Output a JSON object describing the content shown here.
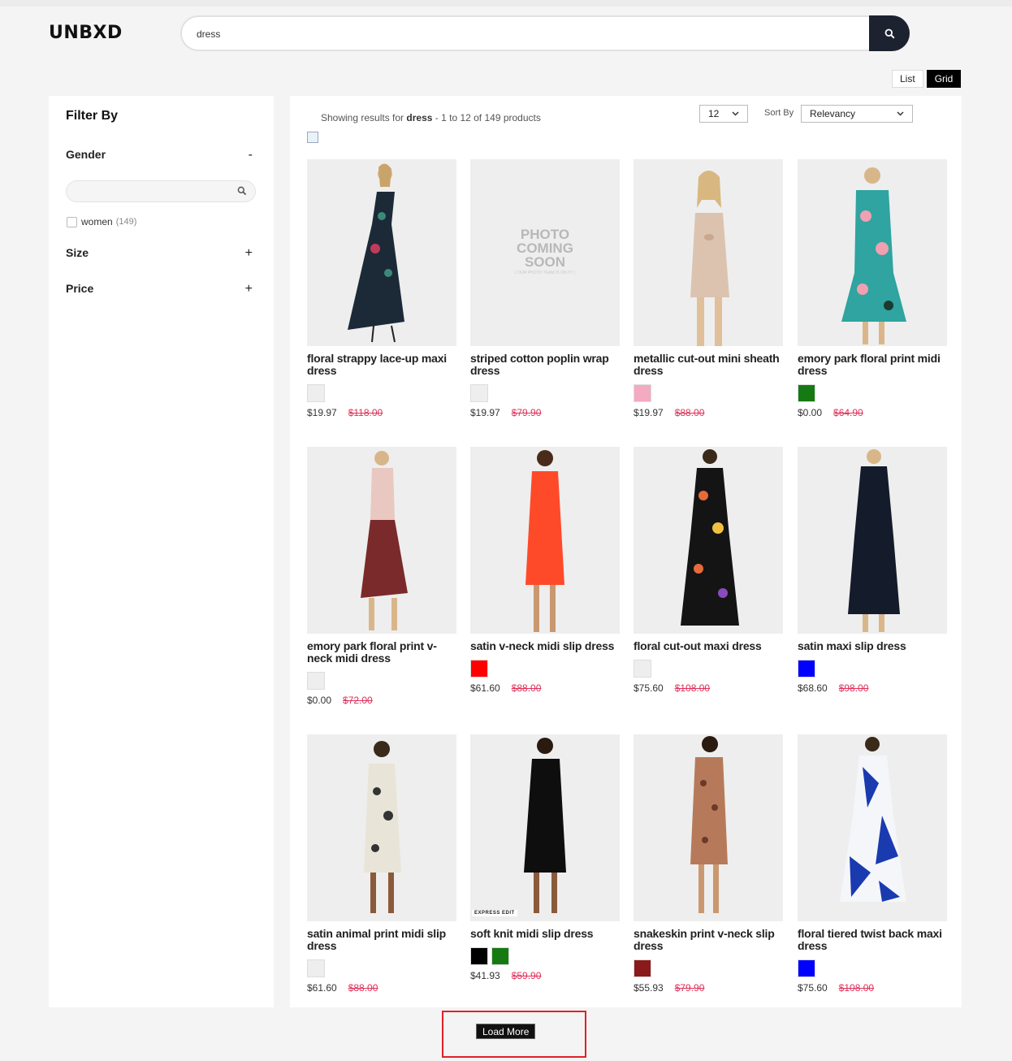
{
  "brand": "UNBXD",
  "search": {
    "value": "dress"
  },
  "view": {
    "list_label": "List",
    "grid_label": "Grid"
  },
  "sidebar": {
    "title": "Filter By",
    "facets": [
      {
        "label": "Gender",
        "toggle": "-"
      },
      {
        "label": "Size",
        "toggle": "+"
      },
      {
        "label": "Price",
        "toggle": "+"
      }
    ],
    "gender_options": [
      {
        "label": "women",
        "count": "(149)"
      }
    ]
  },
  "results": {
    "showing_prefix": "Showing results for",
    "query": "dress",
    "showing_suffix": "- 1 to 12 of 149 products",
    "per_page": "12",
    "sort_label": "Sort By",
    "sort_value": "Relevancy"
  },
  "products": [
    {
      "name": "floral strappy lace-up maxi dress",
      "price": "$19.97",
      "was": "$118.00",
      "swatches": [
        "#eeeeee"
      ]
    },
    {
      "name": "striped cotton poplin wrap dress",
      "price": "$19.97",
      "was": "$79.90",
      "swatches": [
        "#eeeeee"
      ]
    },
    {
      "name": "metallic cut-out mini sheath dress",
      "price": "$19.97",
      "was": "$88.00",
      "swatches": [
        "#f4aac0"
      ]
    },
    {
      "name": "emory park floral print midi dress",
      "price": "$0.00",
      "was": "$64.90",
      "swatches": [
        "#167a12"
      ]
    },
    {
      "name": "emory park floral print v-neck midi dress",
      "price": "$0.00",
      "was": "$72.00",
      "swatches": [
        "#eeeeee"
      ]
    },
    {
      "name": "satin v-neck midi slip dress",
      "price": "$61.60",
      "was": "$88.00",
      "swatches": [
        "#ff0000"
      ]
    },
    {
      "name": "floral cut-out maxi dress",
      "price": "$75.60",
      "was": "$108.00",
      "swatches": [
        "#eeeeee"
      ]
    },
    {
      "name": "satin maxi slip dress",
      "price": "$68.60",
      "was": "$98.00",
      "swatches": [
        "#0000ff"
      ]
    },
    {
      "name": "satin animal print midi slip dress",
      "price": "$61.60",
      "was": "$88.00",
      "swatches": [
        "#eeeeee"
      ]
    },
    {
      "name": "soft knit midi slip dress",
      "price": "$41.93",
      "was": "$59.90",
      "swatches": [
        "#000000",
        "#167a12"
      ]
    },
    {
      "name": "snakeskin print v-neck slip dress",
      "price": "$55.93",
      "was": "$79.90",
      "swatches": [
        "#8b1a1a"
      ]
    },
    {
      "name": "floral tiered twist back maxi dress",
      "price": "$75.60",
      "was": "$108.00",
      "swatches": [
        "#0000ff"
      ]
    }
  ],
  "placeholder": {
    "line1": "PHOTO",
    "line2": "COMING",
    "line3": "SOON",
    "small": "( OUR PHOTO TEAM IS ON IT! )"
  },
  "express_tag": "EXPRESS EDIT",
  "load_more": "Load More"
}
